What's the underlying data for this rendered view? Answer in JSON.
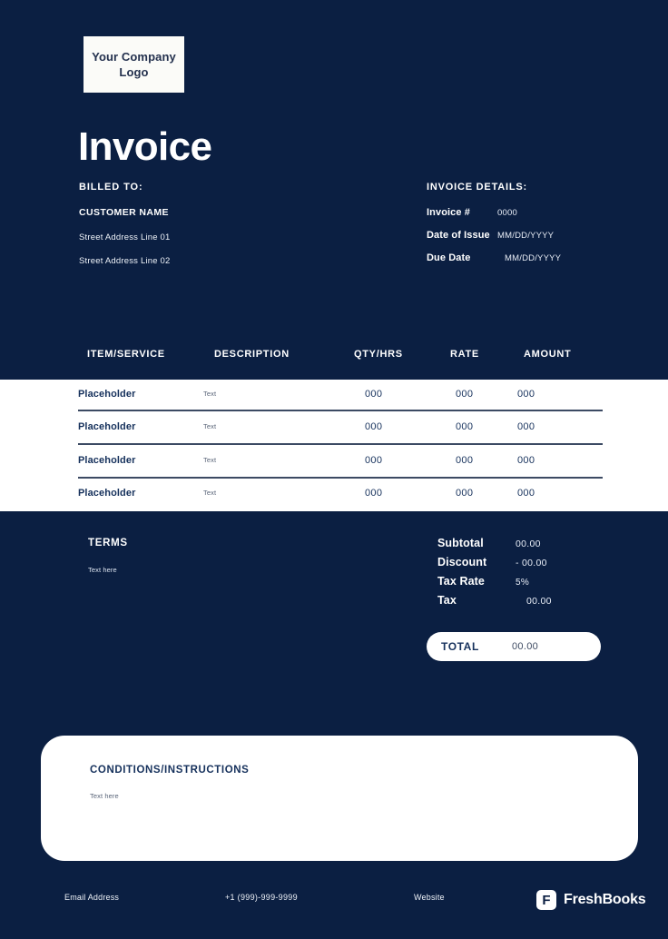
{
  "colors": {
    "background": "#0b1f42",
    "panel": "#ffffff",
    "text_on_dark": "#ffffff",
    "text_on_light": "#16315c",
    "muted": "#5a6579",
    "divider": "#3c4a63"
  },
  "logo": {
    "line1": "Your Company",
    "line2": "Logo",
    "alt": "company-logo-placeholder"
  },
  "header": {
    "title": "Invoice"
  },
  "billed_to": {
    "heading": "BILLED TO:",
    "customer_name": "CUSTOMER NAME",
    "address_lines": [
      "Street Address Line 01",
      "Street Address Line 02"
    ]
  },
  "invoice_details": {
    "heading": "INVOICE DETAILS:",
    "rows": [
      {
        "label": "Invoice #",
        "value": "0000"
      },
      {
        "label": "Date of Issue",
        "value": "MM/DD/YYYY"
      },
      {
        "label": "Due Date",
        "value": "MM/DD/YYYY"
      }
    ]
  },
  "table": {
    "columns": [
      "ITEM/SERVICE",
      "DESCRIPTION",
      "QTY/HRS",
      "RATE",
      "AMOUNT"
    ],
    "rows": [
      {
        "item": "Placeholder",
        "description": "Text",
        "qty": "000",
        "rate": "000",
        "amount": "000"
      },
      {
        "item": "Placeholder",
        "description": "Text",
        "qty": "000",
        "rate": "000",
        "amount": "000"
      },
      {
        "item": "Placeholder",
        "description": "Text",
        "qty": "000",
        "rate": "000",
        "amount": "000"
      },
      {
        "item": "Placeholder",
        "description": "Text",
        "qty": "000",
        "rate": "000",
        "amount": "000"
      }
    ]
  },
  "terms": {
    "heading": "TERMS",
    "text": "Text here"
  },
  "totals": {
    "rows": [
      {
        "label": "Subtotal",
        "value": "00.00"
      },
      {
        "label": "Discount",
        "value": "-  00.00"
      },
      {
        "label": "Tax Rate",
        "value": "5%"
      },
      {
        "label": "Tax",
        "value": "00.00"
      }
    ],
    "total_label": "TOTAL",
    "total_value": "00.00"
  },
  "conditions": {
    "heading": "CONDITIONS/INSTRUCTIONS",
    "text": "Text here"
  },
  "footer": {
    "email": "Email Address",
    "phone": "+1 (999)-999-9999",
    "website": "Website",
    "brand_glyph": "F",
    "brand_name": "FreshBooks"
  }
}
